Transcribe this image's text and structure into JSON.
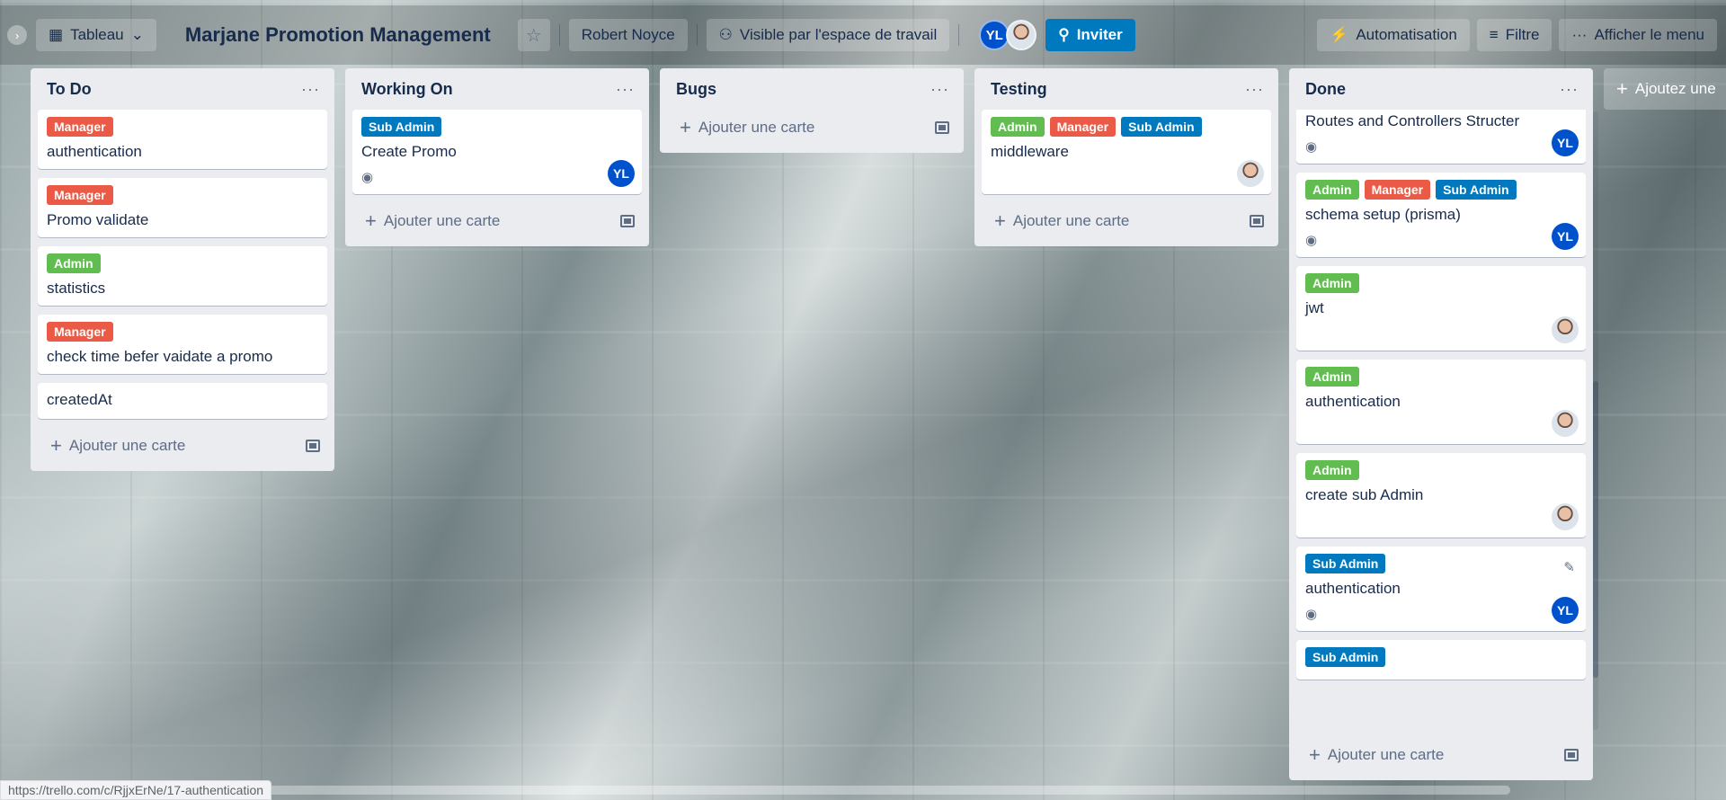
{
  "topbar": {
    "view_label": "Tableau",
    "board_title": "Marjane Promotion Management",
    "workspace_owner": "Robert Noyce",
    "visibility": "Visible par l'espace de travail",
    "member_initials": "YL",
    "invite_label": "Inviter",
    "automation_label": "Automatisation",
    "filter_label": "Filtre",
    "menu_label": "Afficher le menu"
  },
  "add_card_label": "Ajouter une carte",
  "add_list_label": "Ajoutez une",
  "label_colors": {
    "Manager": "#eb5a46",
    "Admin": "#61bd4f",
    "Sub Admin": "#0079bf"
  },
  "lists": [
    {
      "title": "To Do",
      "cards": [
        {
          "labels": [
            "Manager"
          ],
          "title": "authentication"
        },
        {
          "labels": [
            "Manager"
          ],
          "title": "Promo validate"
        },
        {
          "labels": [
            "Admin"
          ],
          "title": "statistics"
        },
        {
          "labels": [
            "Manager"
          ],
          "title": "check time befer vaidate a promo"
        },
        {
          "labels": [],
          "title": "createdAt"
        }
      ]
    },
    {
      "title": "Working On",
      "cards": [
        {
          "labels": [
            "Sub Admin"
          ],
          "title": "Create Promo",
          "watch": true,
          "avatar": "YL"
        }
      ]
    },
    {
      "title": "Bugs",
      "cards": []
    },
    {
      "title": "Testing",
      "cards": [
        {
          "labels": [
            "Admin",
            "Manager",
            "Sub Admin"
          ],
          "title": "middleware",
          "avatar": "photo"
        }
      ]
    },
    {
      "title": "Done",
      "cards": [
        {
          "labels": [],
          "title": "Routes and Controllers Structer",
          "watch": true,
          "avatar": "YL"
        },
        {
          "labels": [
            "Admin",
            "Manager",
            "Sub Admin"
          ],
          "title": "schema setup (prisma)",
          "watch": true,
          "avatar": "YL"
        },
        {
          "labels": [
            "Admin"
          ],
          "title": "jwt",
          "avatar": "photo"
        },
        {
          "labels": [
            "Admin"
          ],
          "title": "authentication",
          "avatar": "photo"
        },
        {
          "labels": [
            "Admin"
          ],
          "title": "create sub Admin",
          "avatar": "photo"
        },
        {
          "labels": [
            "Sub Admin"
          ],
          "title": "authentication",
          "watch": true,
          "avatar": "YL",
          "edit": true
        },
        {
          "labels": [
            "Sub Admin"
          ],
          "title": ""
        }
      ]
    }
  ],
  "status_bar_url": "https://trello.com/c/RjjxErNe/17-authentication"
}
